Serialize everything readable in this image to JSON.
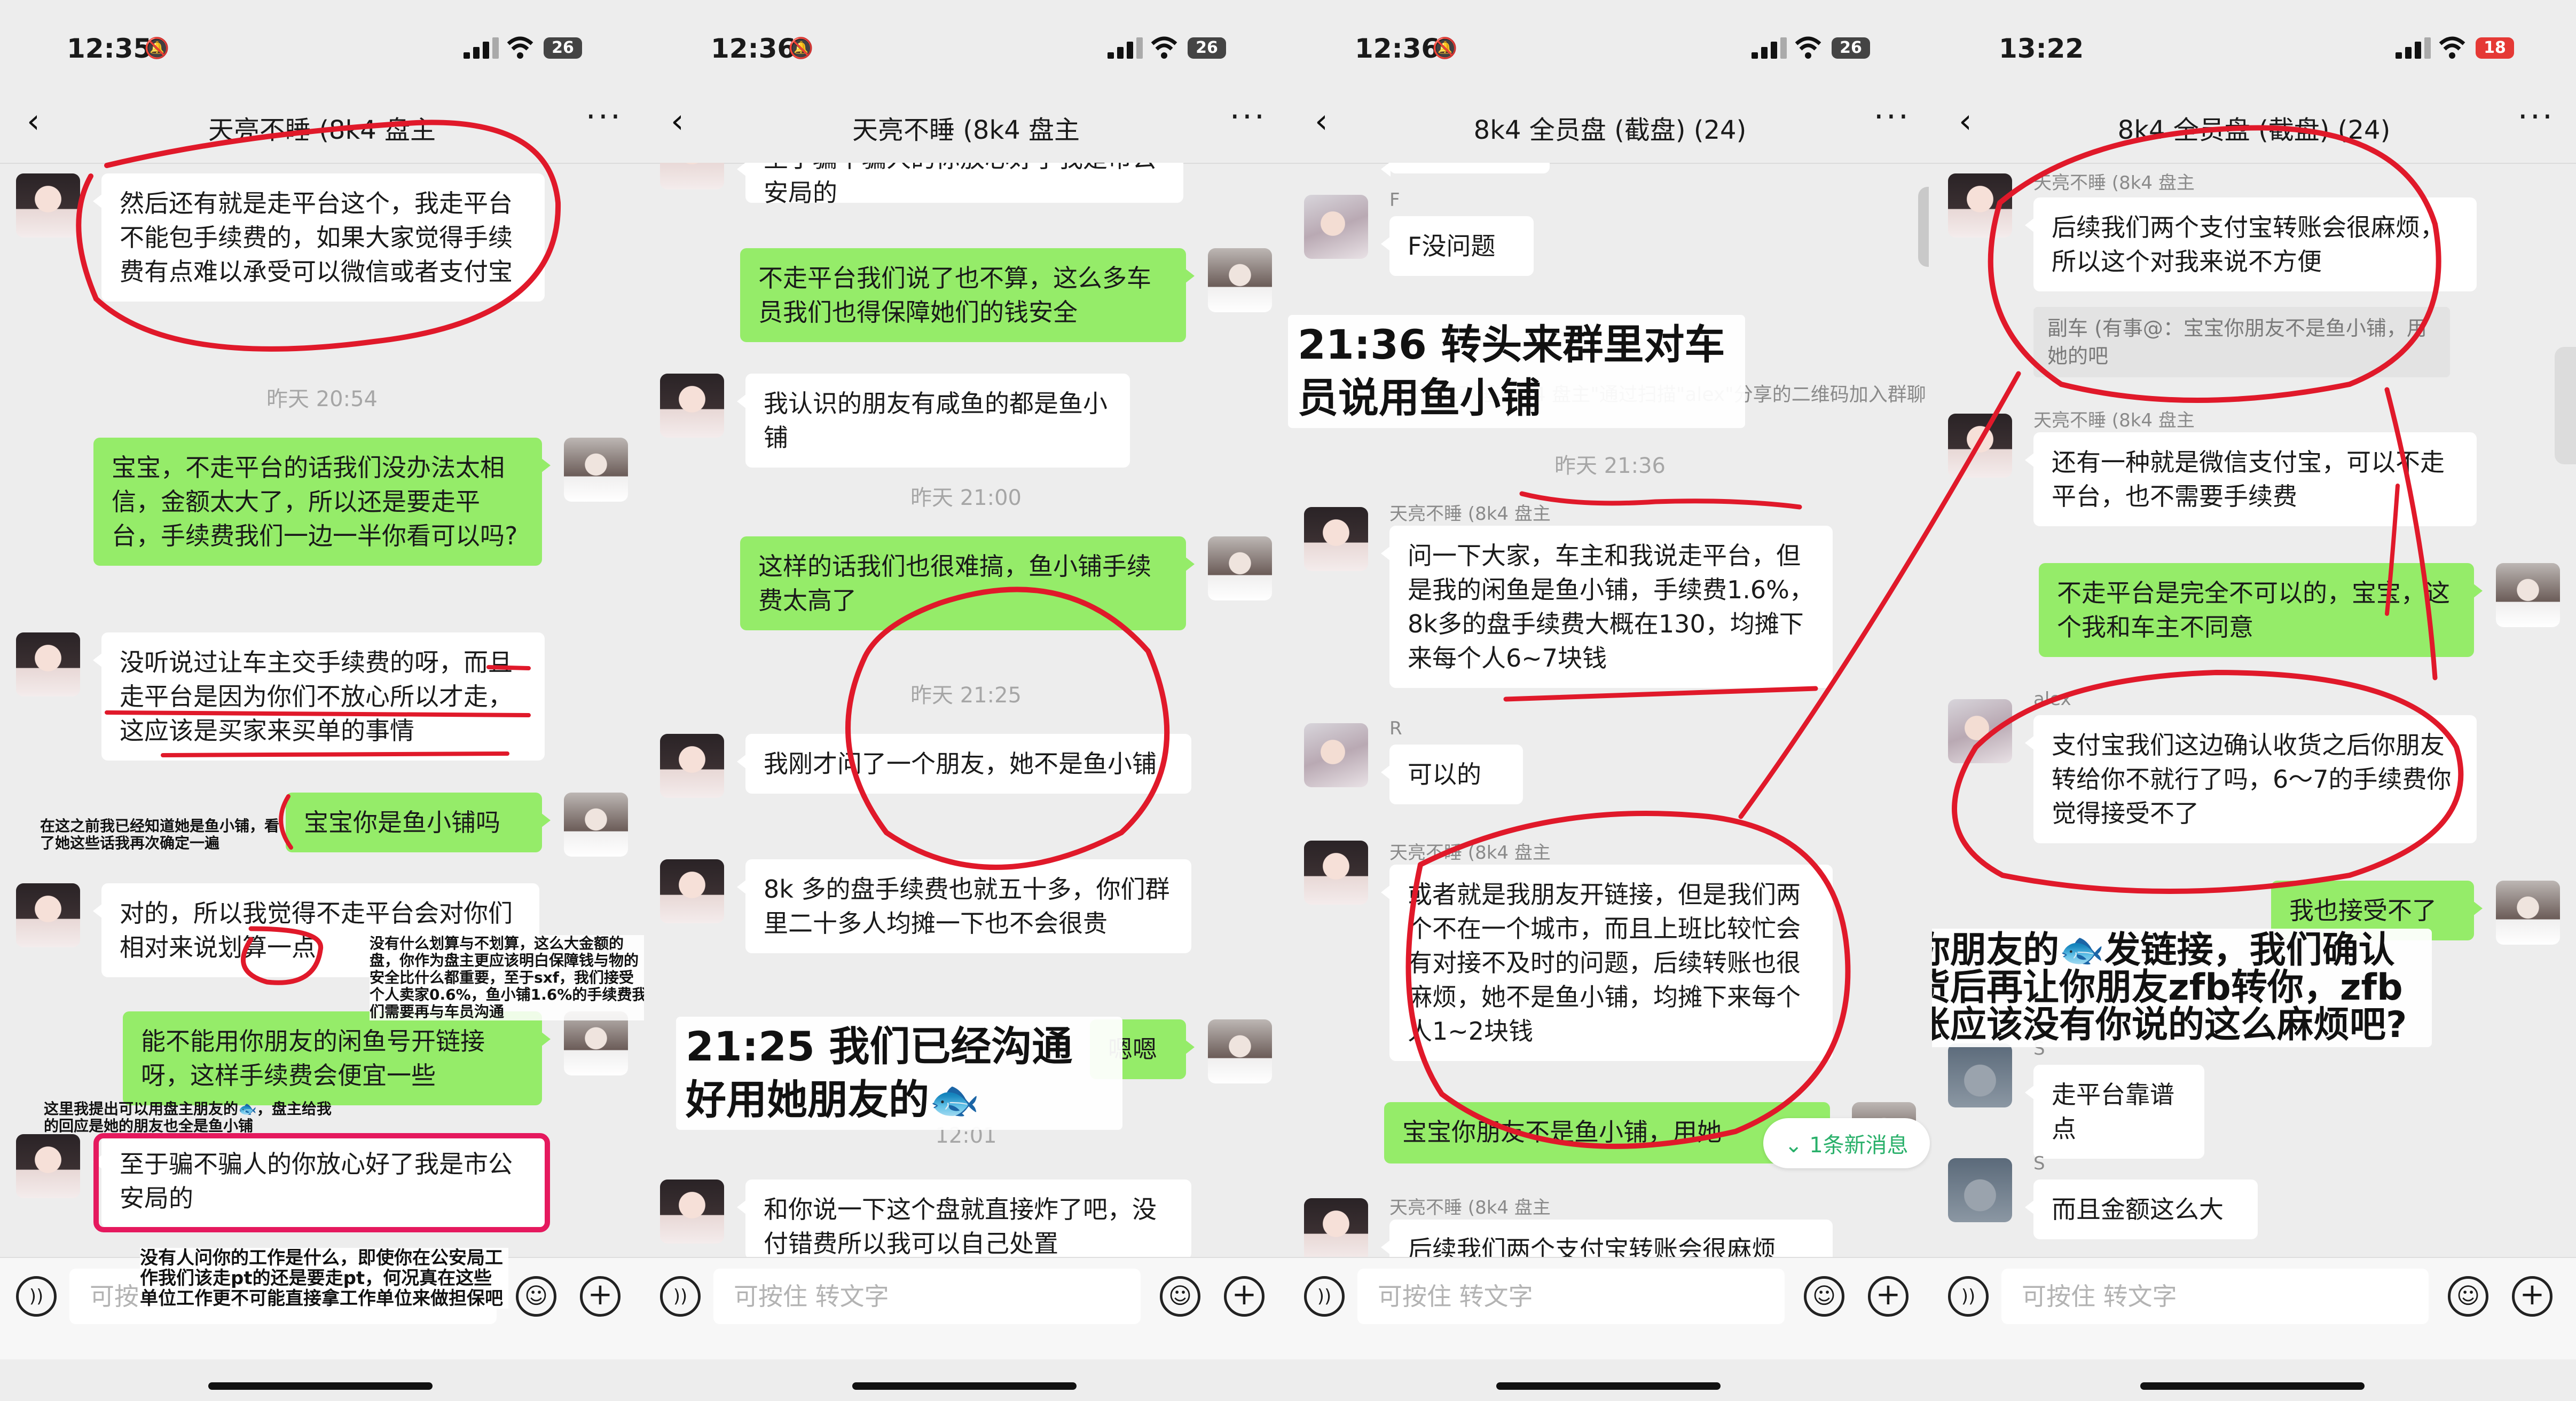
{
  "panels": [
    {
      "status": {
        "time": "12:35",
        "battery": "26"
      },
      "header": {
        "title": "天亮不睡 (8k4 盘主"
      },
      "messages": [
        {
          "text": "然后还有就是走平台这个，我走平台不能包手续费的，如果大家觉得手续费有点难以承受可以微信或者支付宝"
        },
        {
          "time": "昨天 20:54"
        },
        {
          "text": "宝宝，不走平台的话我们没办法太相信，金额太大了，所以还是要走平台，手续费我们一边一半你看可以吗?"
        },
        {
          "text": "没听说过让车主交手续费的呀，而且走平台是因为你们不放心所以才走，这应该是买家来买单的事情"
        },
        {
          "text": "宝宝你是鱼小铺吗"
        },
        {
          "text": "对的，所以我觉得不走平台会对你们相对来说划算一点"
        },
        {
          "text": "能不能用你朋友的闲鱼号开链接呀，这样手续费会便宜一些"
        },
        {
          "text": "至于骗不骗人的你放心好了我是市公安局的"
        }
      ],
      "input_placeholder": "可按住 转文字",
      "annotations": [
        "在这之前我已经知道她是鱼小铺，看了她这些话我再次确定一遍",
        "没有什么划算与不划算，这么大金额的盘，你作为盘主更应该明白保障钱与物的安全比什么都重要，至于sxf，我们接受个人卖家0.6%，鱼小铺1.6%的手续费我们需要再与车员沟通",
        "这里我提出可以用盘主朋友的🐟，盘主给我的回应是她的朋友也全是鱼小铺",
        "没有人问你的工作是什么，即使你在公安局工作我们该走pt的还是要走pt，何况真在这些单位工作更不可能直接拿工作单位来做担保吧"
      ]
    },
    {
      "status": {
        "time": "12:36",
        "battery": "26"
      },
      "header": {
        "title": "天亮不睡 (8k4 盘主"
      },
      "messages": [
        {
          "text": "至于骗不骗人的你放心好了我是市公安局的"
        },
        {
          "text": "不走平台我们说了也不算，这么多车员我们也得保障她们的钱安全"
        },
        {
          "text": "我认识的朋友有咸鱼的都是鱼小铺"
        },
        {
          "time": "昨天 21:00"
        },
        {
          "text": "这样的话我们也很难搞，鱼小铺手续费太高了"
        },
        {
          "time": "昨天 21:25"
        },
        {
          "text": "我刚才问了一个朋友，她不是鱼小铺"
        },
        {
          "text": "8k 多的盘手续费也就五十多，你们群里二十多人均摊一下也不会很贵"
        },
        {
          "text": "嗯嗯"
        },
        {
          "time": "12:01"
        },
        {
          "text": "和你说一下这个盘就直接炸了吧，没付错费所以我可以自己处置"
        }
      ],
      "input_placeholder": "可按住 转文字",
      "annotations": [
        "21:25 我们已经沟通好用她朋友的🐟"
      ]
    },
    {
      "status": {
        "time": "12:36",
        "battery": "26"
      },
      "header": {
        "title": "8k4 全员盘 (截盘) (24)"
      },
      "messages": [
        {
          "name": "F",
          "text": "F没问题"
        },
        {
          "text": "\"天亮不睡 (8k4 盘主\"通过扫描\"alex\"分享的二维码加入群聊"
        },
        {
          "time": "昨天 21:36"
        },
        {
          "name": "天亮不睡 (8k4 盘主",
          "text": "问一下大家，车主和我说走平台，但是我的闲鱼是鱼小铺，手续费1.6%，8k多的盘手续费大概在130，均摊下来每个人6~7块钱"
        },
        {
          "name": "R",
          "text": "可以的"
        },
        {
          "name": "天亮不睡 (8k4 盘主",
          "text": "或者就是我朋友开链接，但是我们两个不在一个城市，而且上班比较忙会有对接不及时的问题，后续转账也很麻烦，她不是鱼小铺，均摊下来每个人1~2块钱"
        },
        {
          "text": "宝宝你朋友不是鱼小铺，用她"
        },
        {
          "name": "天亮不睡 (8k4 盘主",
          "text": "后续我们两个支付宝转账会很麻烦"
        }
      ],
      "new_messages": "1条新消息",
      "input_placeholder": "可按住 转文字",
      "annotations": [
        "21:36 转头来群里对车员说用鱼小铺"
      ]
    },
    {
      "status": {
        "time": "13:22",
        "battery": "18"
      },
      "header": {
        "title": "8k4 全员盘 (截盘) (24)"
      },
      "messages": [
        {
          "name": "天亮不睡 (8k4 盘主",
          "text": "后续我们两个支付宝转账会很麻烦，所以这个对我来说不方便"
        },
        {
          "quote": "副车 (有事@：宝宝你朋友不是鱼小铺，用她的吧"
        },
        {
          "name": "天亮不睡 (8k4 盘主",
          "text": "还有一种就是微信支付宝，可以不走平台，也不需要手续费"
        },
        {
          "text": "不走平台是完全不可以的，宝宝，这个我和车主不同意"
        },
        {
          "name": "alex",
          "text": "支付宝我们这边确认收货之后你朋友转给你不就行了吗，6～7的手续费你觉得接受不了"
        },
        {
          "text": "我也接受不了"
        },
        {
          "name": "S",
          "text": "走平台靠谱点"
        },
        {
          "name": "S",
          "text": "而且金额这么大"
        }
      ],
      "input_placeholder": "可按住 转文字",
      "annotations": [
        "用你朋友的🐟发链接，我们确认收货后再让你朋友zfb转你，zfb转账应该没有你说的这么麻烦吧?"
      ]
    }
  ],
  "colors": {
    "green_bubble": "#95ec69",
    "white_bubble": "#ffffff",
    "background": "#ededed",
    "ink_red": "#e0192a",
    "ink_pink": "#e5195e"
  }
}
